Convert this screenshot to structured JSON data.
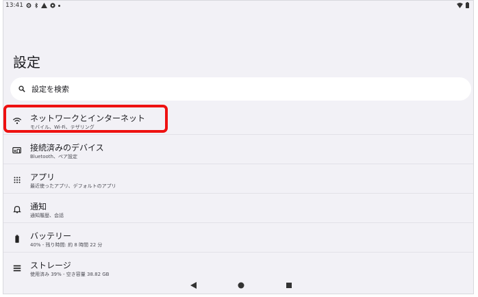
{
  "status_bar": {
    "time": "13:41",
    "icons_left": [
      "gear-icon",
      "bluetooth-icon",
      "warning-icon",
      "hotspot-icon",
      "dot-icon"
    ],
    "icons_right": [
      "wifi-icon",
      "battery-icon"
    ]
  },
  "page": {
    "title": "設定"
  },
  "search": {
    "placeholder": "設定を検索"
  },
  "settings": [
    {
      "title": "ネットワークとインターネット",
      "subtitle": "モバイル、Wi-Fi、テザリング",
      "icon": "wifi-icon"
    },
    {
      "title": "接続済みのデバイス",
      "subtitle": "Bluetooth、ペア設定",
      "icon": "devices-icon"
    },
    {
      "title": "アプリ",
      "subtitle": "最近使ったアプリ、デフォルトのアプリ",
      "icon": "apps-grid-icon"
    },
    {
      "title": "通知",
      "subtitle": "通知履歴、会話",
      "icon": "bell-icon"
    },
    {
      "title": "バッテリー",
      "subtitle": "40% - 残り時間: 約 8 時間 22 分",
      "icon": "battery-icon"
    },
    {
      "title": "ストレージ",
      "subtitle": "使用済み 39% - 空き容量 38.82 GB",
      "icon": "storage-icon"
    }
  ],
  "highlight_color": "#ee1111",
  "nav_bar": {
    "buttons": [
      "back-icon",
      "home-icon",
      "recents-icon"
    ]
  }
}
